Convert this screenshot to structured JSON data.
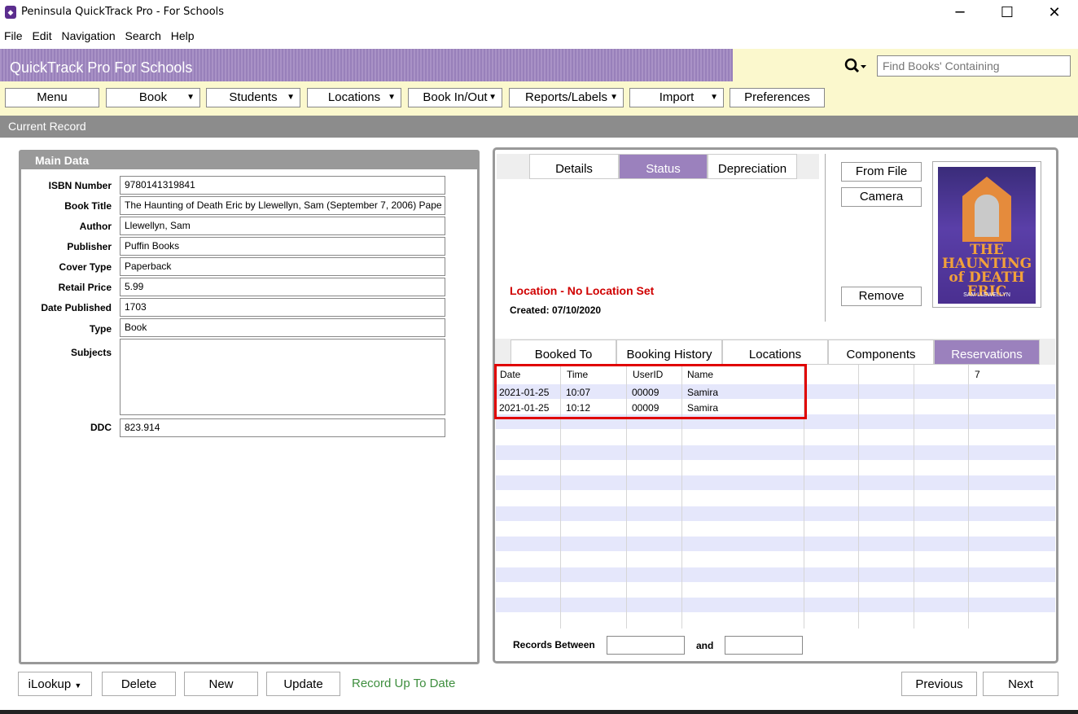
{
  "window": {
    "title": "Peninsula QuickTrack Pro - For Schools",
    "minimize": "─",
    "maximize": "☐",
    "close": "✕"
  },
  "menubar": [
    "File",
    "Edit",
    "Navigation",
    "Search",
    "Help"
  ],
  "header": {
    "heading": "QuickTrack Pro For Schools",
    "search_placeholder": "Find Books' Containing",
    "search_icon": "magnifier-icon"
  },
  "toolbar": [
    {
      "label": "Menu",
      "dropdown": false
    },
    {
      "label": "Book",
      "dropdown": true
    },
    {
      "label": "Students",
      "dropdown": true
    },
    {
      "label": "Locations",
      "dropdown": true
    },
    {
      "label": "Book In/Out",
      "dropdown": true
    },
    {
      "label": "Reports/Labels",
      "dropdown": true
    },
    {
      "label": "Import",
      "dropdown": true
    },
    {
      "label": "Preferences",
      "dropdown": false
    }
  ],
  "section_bar": "Current Record",
  "main_data": {
    "heading": "Main Data",
    "fields": [
      {
        "label": "ISBN Number",
        "value": "9780141319841"
      },
      {
        "label": "Book Title",
        "value": "The Haunting of Death Eric by Llewellyn, Sam (September 7, 2006) Pape"
      },
      {
        "label": "Author",
        "value": "Llewellyn, Sam"
      },
      {
        "label": "Publisher",
        "value": "Puffin Books"
      },
      {
        "label": "Cover Type",
        "value": "Paperback"
      },
      {
        "label": "Retail Price",
        "value": "5.99"
      },
      {
        "label": "Date Published",
        "value": "1703"
      },
      {
        "label": "Type",
        "value": "Book"
      }
    ],
    "subjects_label": "Subjects",
    "subjects_value": "",
    "ddc_label": "DDC",
    "ddc_value": "823.914"
  },
  "status_tabs": [
    {
      "label": "Details",
      "active": false
    },
    {
      "label": "Status",
      "active": true
    },
    {
      "label": "Depreciation",
      "active": false
    }
  ],
  "status": {
    "location": "Location - No Location Set",
    "created": "Created: 07/10/2020"
  },
  "image_buttons": {
    "from_file": "From File",
    "camera": "Camera",
    "remove": "Remove"
  },
  "cover": {
    "title": "THE HAUNTING of DEATH ERIC",
    "author": "SAM LLEWELLYN"
  },
  "grid_tabs": [
    {
      "label": "Booked To",
      "active": false
    },
    {
      "label": "Booking History",
      "active": false
    },
    {
      "label": "Locations",
      "active": false
    },
    {
      "label": "Components",
      "active": false
    },
    {
      "label": "Reservations",
      "active": true
    }
  ],
  "grid": {
    "headers": [
      "Date",
      "Time",
      "UserID",
      "Name"
    ],
    "extra_header": "7",
    "rows": [
      [
        "2021-01-25",
        "10:07",
        "00009",
        "Samira"
      ],
      [
        "2021-01-25",
        "10:12",
        "00009",
        "Samira"
      ]
    ]
  },
  "filter": {
    "records_between": "Records Between",
    "and": "and"
  },
  "bottom": {
    "ilookup": "iLookup",
    "delete": "Delete",
    "new": "New",
    "update": "Update",
    "status": "Record Up To Date",
    "previous": "Previous",
    "next": "Next"
  },
  "colors": {
    "purple": "#9b81bd",
    "cream": "#fbf8cd",
    "highlight": "#e00000",
    "status_green": "#3e8e3e"
  }
}
